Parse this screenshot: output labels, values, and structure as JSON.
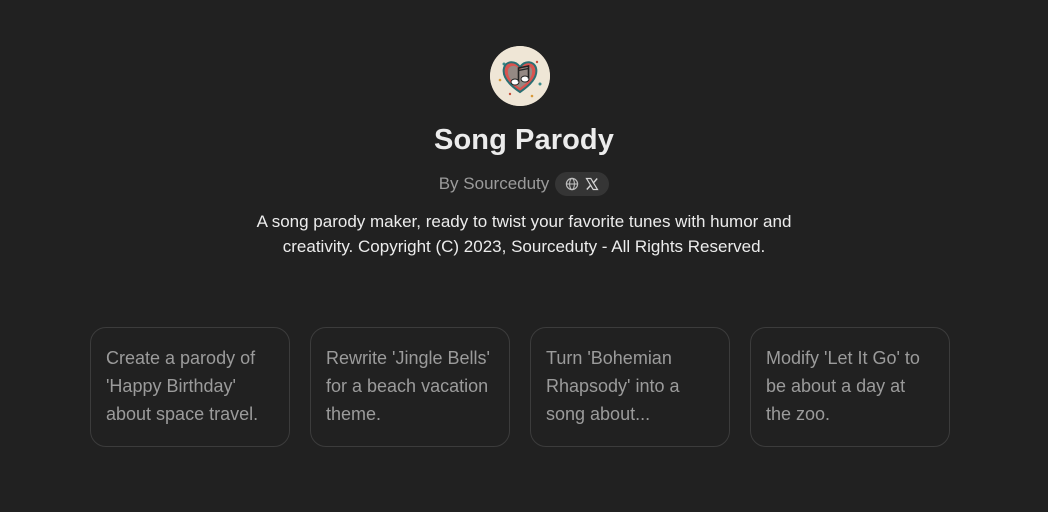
{
  "gpt": {
    "title": "Song Parody",
    "author_label": "By Sourceduty",
    "description": "A song parody maker, ready to twist your favorite tunes with humor and creativity. Copyright (C) 2023, Sourceduty - All Rights Reserved.",
    "social_icons": [
      "globe-icon",
      "x-logo-icon"
    ]
  },
  "conversation_starters": [
    {
      "label": "Create a parody of 'Happy Birthday' about space travel."
    },
    {
      "label": "Rewrite 'Jingle Bells' for a beach vacation theme."
    },
    {
      "label": "Turn 'Bohemian Rhapsody' into a song about..."
    },
    {
      "label": "Modify 'Let It Go' to be about a day at the zoo."
    }
  ],
  "colors": {
    "background": "#212121",
    "title": "#ececec",
    "muted": "#9b9b9b",
    "card_border": "#3c3c3c",
    "pill": "#353535"
  }
}
